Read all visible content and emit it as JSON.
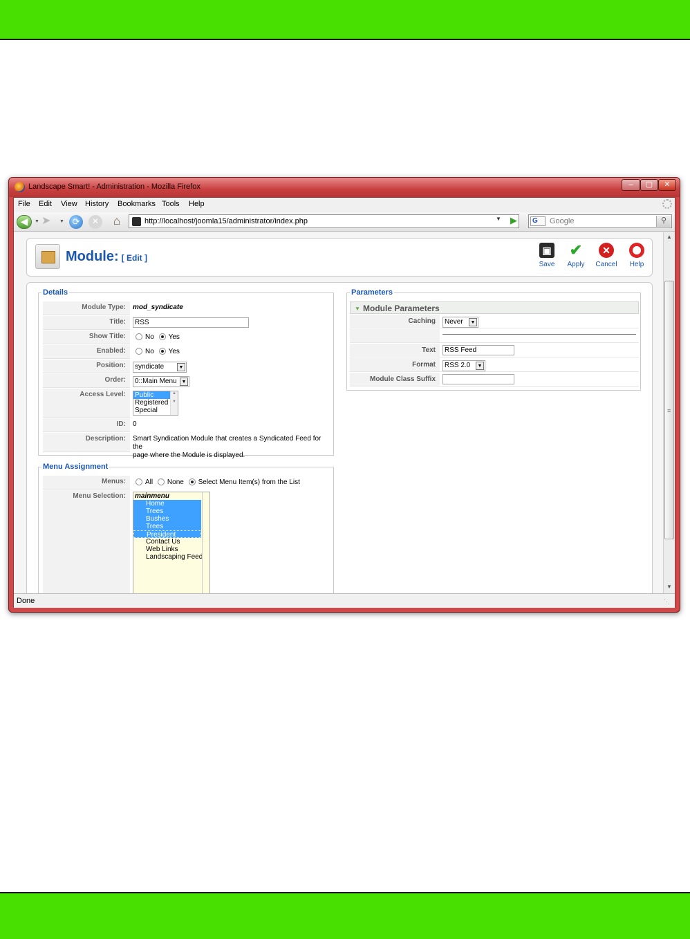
{
  "window": {
    "title": "Landscape Smart! - Administration - Mozilla Firefox",
    "min": "–",
    "max": "▢",
    "close": "✕"
  },
  "menubar": [
    {
      "label": "File"
    },
    {
      "label": "Edit"
    },
    {
      "label": "View"
    },
    {
      "label": "History"
    },
    {
      "label": "Bookmarks"
    },
    {
      "label": "Tools"
    },
    {
      "label": "Help"
    }
  ],
  "navbar": {
    "url": "http://localhost/joomla15/administrator/index.php",
    "search_placeholder": "Google",
    "search_engine": "G"
  },
  "page": {
    "title": "Module:",
    "subtitle": "[ Edit ]",
    "toolbar": {
      "save": "Save",
      "apply": "Apply",
      "cancel": "Cancel",
      "help": "Help"
    }
  },
  "details": {
    "legend": "Details",
    "module_type_label": "Module Type:",
    "module_type_value": "mod_syndicate",
    "title_label": "Title:",
    "title_value": "RSS",
    "show_title_label": "Show Title:",
    "show_title_no": "No",
    "show_title_yes": "Yes",
    "enabled_label": "Enabled:",
    "enabled_no": "No",
    "enabled_yes": "Yes",
    "position_label": "Position:",
    "position_value": "syndicate",
    "order_label": "Order:",
    "order_value": "0::Main Menu",
    "access_label": "Access Level:",
    "access_options": [
      "Public",
      "Registered",
      "Special"
    ],
    "id_label": "ID:",
    "id_value": "0",
    "description_label": "Description:",
    "description_line1": "Smart Syndication Module that creates a Syndicated Feed for the",
    "description_line2": "page where the Module is displayed."
  },
  "menu_assignment": {
    "legend": "Menu Assignment",
    "menus_label": "Menus:",
    "opt_all": "All",
    "opt_none": "None",
    "opt_select": "Select Menu Item(s) from the List",
    "selection_label": "Menu Selection:",
    "group": "mainmenu",
    "items": [
      "Home",
      "Trees",
      "Bushes",
      "Trees",
      "President",
      "Contact Us",
      "Web Links",
      "Landscaping Feeds"
    ]
  },
  "parameters": {
    "legend": "Parameters",
    "header": "Module Parameters",
    "caching_label": "Caching",
    "caching_value": "Never",
    "text_label": "Text",
    "text_value": "RSS Feed",
    "format_label": "Format",
    "format_value": "RSS 2.0",
    "suffix_label": "Module Class Suffix",
    "suffix_value": ""
  },
  "status": {
    "text": "Done"
  },
  "colors": {
    "band": "#47e000",
    "title_bar": "#d24848",
    "accent_blue": "#1b56b0",
    "selection": "#3ea0ff"
  }
}
